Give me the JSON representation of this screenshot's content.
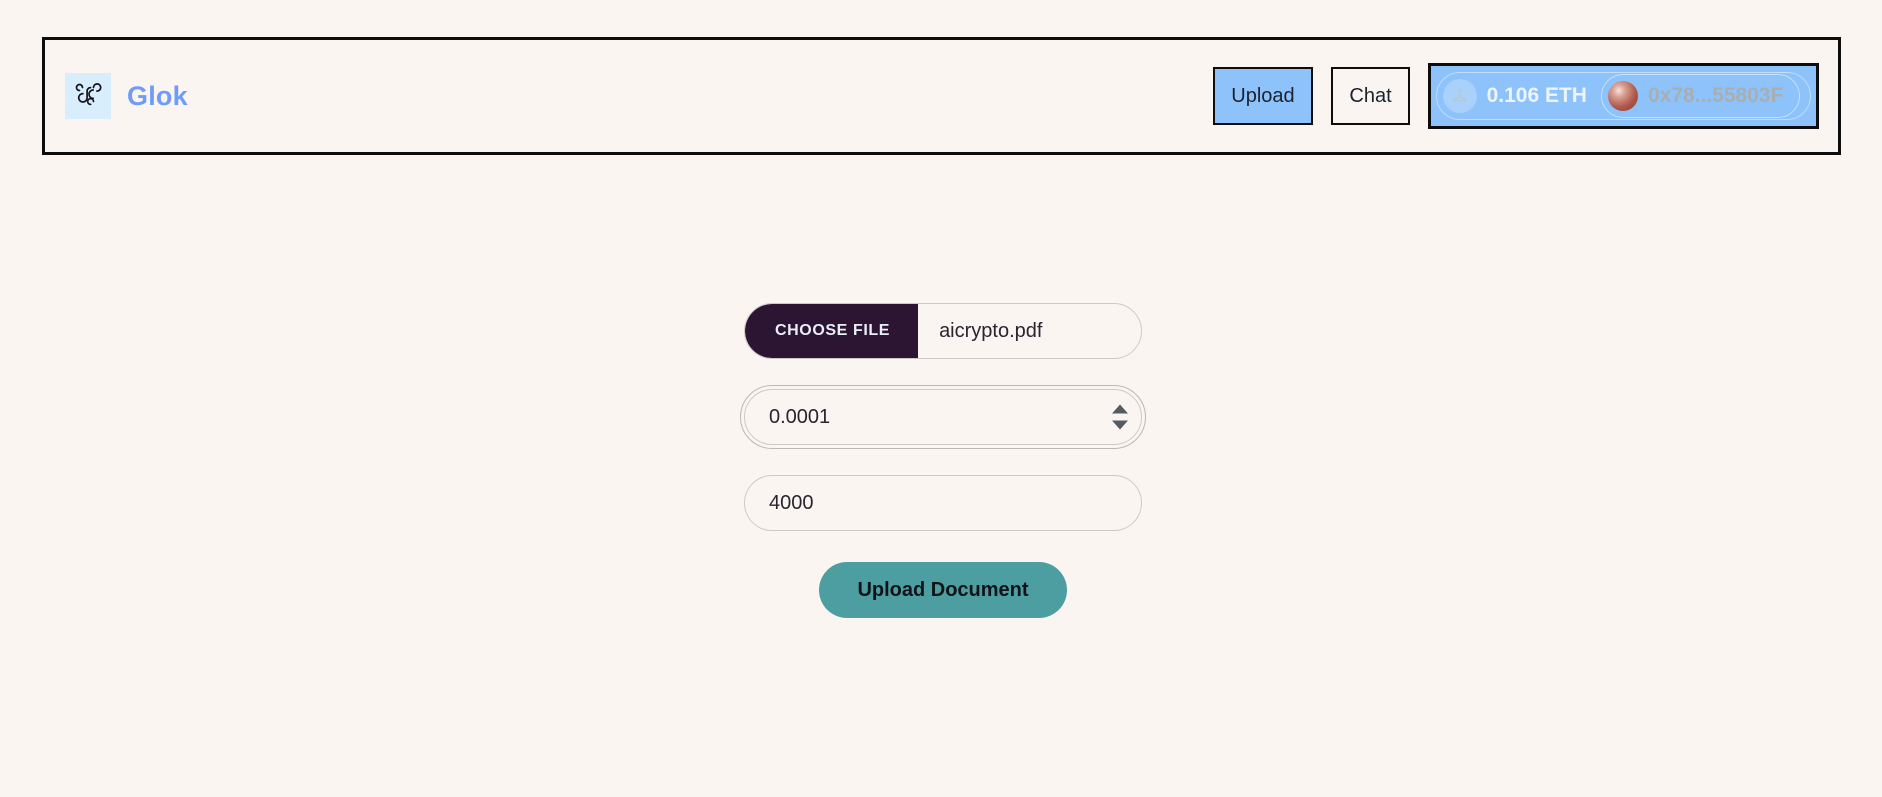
{
  "theme": {
    "page_background": "#faf5f1",
    "brand_blue": "#6f9cf8",
    "accent_blue": "#8dc2fb",
    "dark_purple": "#2c1433",
    "teal": "#4d9ea1",
    "border_black": "#0d0d0d"
  },
  "header": {
    "logo_icon": "glok-knot-logo-icon",
    "brand_name": "Glok",
    "buttons": {
      "upload_label": "Upload",
      "chat_label": "Chat"
    },
    "wallet": {
      "network_icon": "network-nodes-icon",
      "balance": "0.106 ETH",
      "avatar_icon": "wallet-avatar-sphere",
      "address": "0x78...55803F"
    }
  },
  "form": {
    "file_field": {
      "button_label": "CHOOSE FILE",
      "file_name": "aicrypto.pdf"
    },
    "price_field": {
      "value": "0.0001",
      "placeholder": "Price in ETH",
      "spinner_up_icon": "spinner-up-arrow-icon",
      "spinner_down_icon": "spinner-down-arrow-icon"
    },
    "supply_field": {
      "value": "4000",
      "placeholder": "Supply"
    },
    "submit_label": "Upload Document"
  }
}
